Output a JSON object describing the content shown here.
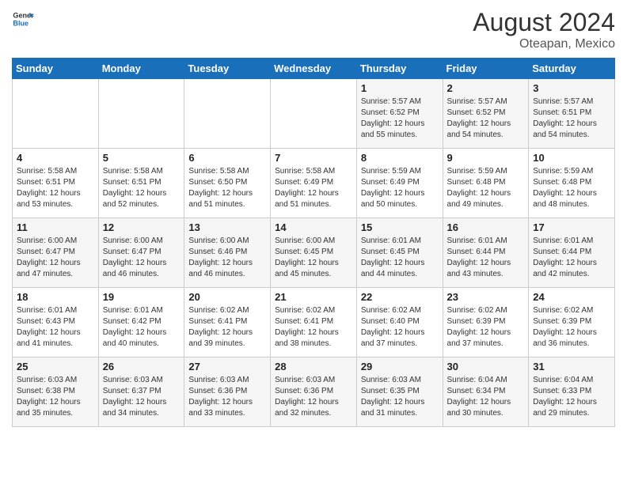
{
  "header": {
    "logo_general": "General",
    "logo_blue": "Blue",
    "month_year": "August 2024",
    "location": "Oteapan, Mexico"
  },
  "days_of_week": [
    "Sunday",
    "Monday",
    "Tuesday",
    "Wednesday",
    "Thursday",
    "Friday",
    "Saturday"
  ],
  "weeks": [
    [
      {
        "day": "",
        "info": ""
      },
      {
        "day": "",
        "info": ""
      },
      {
        "day": "",
        "info": ""
      },
      {
        "day": "",
        "info": ""
      },
      {
        "day": "1",
        "info": "Sunrise: 5:57 AM\nSunset: 6:52 PM\nDaylight: 12 hours\nand 55 minutes."
      },
      {
        "day": "2",
        "info": "Sunrise: 5:57 AM\nSunset: 6:52 PM\nDaylight: 12 hours\nand 54 minutes."
      },
      {
        "day": "3",
        "info": "Sunrise: 5:57 AM\nSunset: 6:51 PM\nDaylight: 12 hours\nand 54 minutes."
      }
    ],
    [
      {
        "day": "4",
        "info": "Sunrise: 5:58 AM\nSunset: 6:51 PM\nDaylight: 12 hours\nand 53 minutes."
      },
      {
        "day": "5",
        "info": "Sunrise: 5:58 AM\nSunset: 6:51 PM\nDaylight: 12 hours\nand 52 minutes."
      },
      {
        "day": "6",
        "info": "Sunrise: 5:58 AM\nSunset: 6:50 PM\nDaylight: 12 hours\nand 51 minutes."
      },
      {
        "day": "7",
        "info": "Sunrise: 5:58 AM\nSunset: 6:49 PM\nDaylight: 12 hours\nand 51 minutes."
      },
      {
        "day": "8",
        "info": "Sunrise: 5:59 AM\nSunset: 6:49 PM\nDaylight: 12 hours\nand 50 minutes."
      },
      {
        "day": "9",
        "info": "Sunrise: 5:59 AM\nSunset: 6:48 PM\nDaylight: 12 hours\nand 49 minutes."
      },
      {
        "day": "10",
        "info": "Sunrise: 5:59 AM\nSunset: 6:48 PM\nDaylight: 12 hours\nand 48 minutes."
      }
    ],
    [
      {
        "day": "11",
        "info": "Sunrise: 6:00 AM\nSunset: 6:47 PM\nDaylight: 12 hours\nand 47 minutes."
      },
      {
        "day": "12",
        "info": "Sunrise: 6:00 AM\nSunset: 6:47 PM\nDaylight: 12 hours\nand 46 minutes."
      },
      {
        "day": "13",
        "info": "Sunrise: 6:00 AM\nSunset: 6:46 PM\nDaylight: 12 hours\nand 46 minutes."
      },
      {
        "day": "14",
        "info": "Sunrise: 6:00 AM\nSunset: 6:45 PM\nDaylight: 12 hours\nand 45 minutes."
      },
      {
        "day": "15",
        "info": "Sunrise: 6:01 AM\nSunset: 6:45 PM\nDaylight: 12 hours\nand 44 minutes."
      },
      {
        "day": "16",
        "info": "Sunrise: 6:01 AM\nSunset: 6:44 PM\nDaylight: 12 hours\nand 43 minutes."
      },
      {
        "day": "17",
        "info": "Sunrise: 6:01 AM\nSunset: 6:44 PM\nDaylight: 12 hours\nand 42 minutes."
      }
    ],
    [
      {
        "day": "18",
        "info": "Sunrise: 6:01 AM\nSunset: 6:43 PM\nDaylight: 12 hours\nand 41 minutes."
      },
      {
        "day": "19",
        "info": "Sunrise: 6:01 AM\nSunset: 6:42 PM\nDaylight: 12 hours\nand 40 minutes."
      },
      {
        "day": "20",
        "info": "Sunrise: 6:02 AM\nSunset: 6:41 PM\nDaylight: 12 hours\nand 39 minutes."
      },
      {
        "day": "21",
        "info": "Sunrise: 6:02 AM\nSunset: 6:41 PM\nDaylight: 12 hours\nand 38 minutes."
      },
      {
        "day": "22",
        "info": "Sunrise: 6:02 AM\nSunset: 6:40 PM\nDaylight: 12 hours\nand 37 minutes."
      },
      {
        "day": "23",
        "info": "Sunrise: 6:02 AM\nSunset: 6:39 PM\nDaylight: 12 hours\nand 37 minutes."
      },
      {
        "day": "24",
        "info": "Sunrise: 6:02 AM\nSunset: 6:39 PM\nDaylight: 12 hours\nand 36 minutes."
      }
    ],
    [
      {
        "day": "25",
        "info": "Sunrise: 6:03 AM\nSunset: 6:38 PM\nDaylight: 12 hours\nand 35 minutes."
      },
      {
        "day": "26",
        "info": "Sunrise: 6:03 AM\nSunset: 6:37 PM\nDaylight: 12 hours\nand 34 minutes."
      },
      {
        "day": "27",
        "info": "Sunrise: 6:03 AM\nSunset: 6:36 PM\nDaylight: 12 hours\nand 33 minutes."
      },
      {
        "day": "28",
        "info": "Sunrise: 6:03 AM\nSunset: 6:36 PM\nDaylight: 12 hours\nand 32 minutes."
      },
      {
        "day": "29",
        "info": "Sunrise: 6:03 AM\nSunset: 6:35 PM\nDaylight: 12 hours\nand 31 minutes."
      },
      {
        "day": "30",
        "info": "Sunrise: 6:04 AM\nSunset: 6:34 PM\nDaylight: 12 hours\nand 30 minutes."
      },
      {
        "day": "31",
        "info": "Sunrise: 6:04 AM\nSunset: 6:33 PM\nDaylight: 12 hours\nand 29 minutes."
      }
    ]
  ]
}
